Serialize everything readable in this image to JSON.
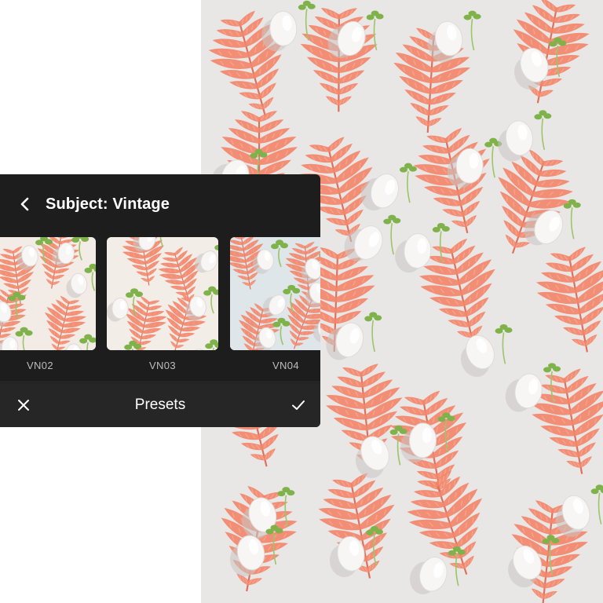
{
  "panel": {
    "back_icon": "chevron-left-icon",
    "title": "Subject: Vintage"
  },
  "presets": [
    {
      "label": "VN02",
      "tint": "#f2ebe6"
    },
    {
      "label": "VN03",
      "tint": "#f3ede8"
    },
    {
      "label": "VN04",
      "tint": "#dfe6ea"
    }
  ],
  "footer": {
    "close_icon": "close-icon",
    "title": "Presets",
    "confirm_icon": "checkmark-icon"
  },
  "colors": {
    "panel_bg": "#1d1d1d",
    "footer_bg": "#262626",
    "fern": "#f2876b",
    "fern_dark": "#e0705a",
    "photo_bg": "#e9e7e6",
    "sprout": "#7fb24a"
  }
}
